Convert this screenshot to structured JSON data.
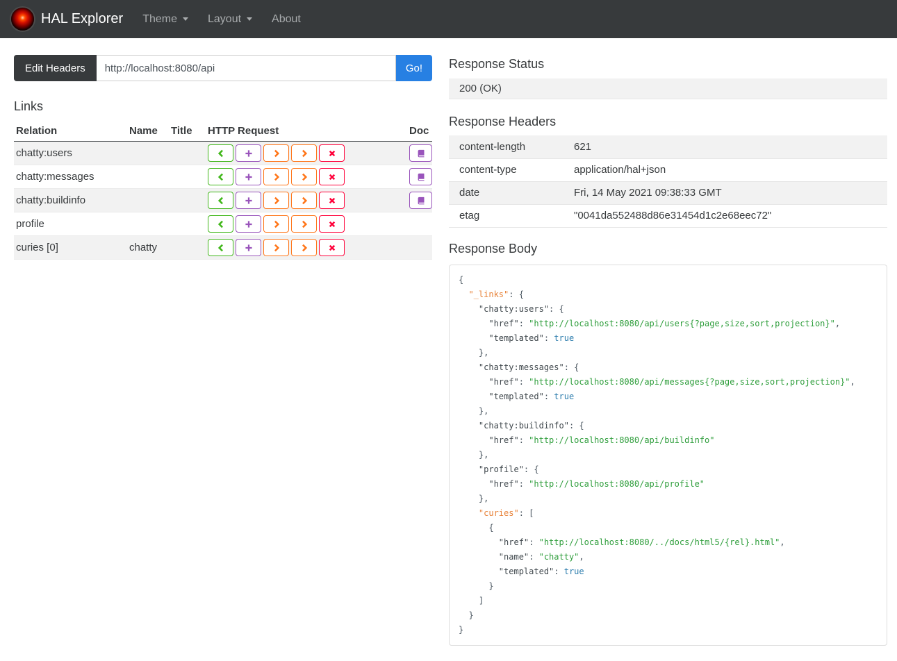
{
  "navbar": {
    "brand": "HAL Explorer",
    "items": [
      {
        "label": "Theme",
        "caret": true
      },
      {
        "label": "Layout",
        "caret": true
      },
      {
        "label": "About",
        "caret": false
      }
    ]
  },
  "request_bar": {
    "edit_headers_label": "Edit Headers",
    "url_value": "http://localhost:8080/api",
    "go_label": "Go!"
  },
  "colors": {
    "primary": "#2780e3",
    "success": "#3fb618",
    "info": "#9954bb",
    "warning": "#ff7518",
    "danger": "#ff0039",
    "dark": "#373a3c"
  },
  "links_section": {
    "title": "Links",
    "columns": [
      "Relation",
      "Name",
      "Title",
      "HTTP Request",
      "Doc"
    ],
    "http_buttons": [
      {
        "name": "get-request-button",
        "icon": "chevron-left-icon",
        "color": "#3fb618"
      },
      {
        "name": "post-request-button",
        "icon": "plus-icon",
        "color": "#9954bb"
      },
      {
        "name": "put-request-button",
        "icon": "chevron-right-icon",
        "color": "#ff7518"
      },
      {
        "name": "patch-request-button",
        "icon": "chevron-right-icon",
        "color": "#ff7518"
      },
      {
        "name": "delete-request-button",
        "icon": "x-icon",
        "color": "#ff0039"
      }
    ],
    "doc_button": {
      "name": "doc-button",
      "icon": "book-icon",
      "color": "#9954bb"
    },
    "rows": [
      {
        "relation": "chatty:users",
        "name": "",
        "title": "",
        "doc": true
      },
      {
        "relation": "chatty:messages",
        "name": "",
        "title": "",
        "doc": true
      },
      {
        "relation": "chatty:buildinfo",
        "name": "",
        "title": "",
        "doc": true
      },
      {
        "relation": "profile",
        "name": "",
        "title": "",
        "doc": false
      },
      {
        "relation": "curies [0]",
        "name": "chatty",
        "title": "",
        "doc": false
      }
    ]
  },
  "response_status": {
    "title": "Response Status",
    "value": "200 (OK)"
  },
  "response_headers": {
    "title": "Response Headers",
    "rows": [
      {
        "name": "content-length",
        "value": "621"
      },
      {
        "name": "content-type",
        "value": "application/hal+json"
      },
      {
        "name": "date",
        "value": "Fri, 14 May 2021 09:38:33 GMT"
      },
      {
        "name": "etag",
        "value": "\"0041da552488d86e31454d1c2e68eec72\""
      }
    ]
  },
  "response_body": {
    "title": "Response Body",
    "lines": [
      [
        {
          "t": "{",
          "c": "p"
        }
      ],
      [
        {
          "t": "  \"_links\"",
          "c": "s"
        },
        {
          "t": ": {",
          "c": "p"
        }
      ],
      [
        {
          "t": "    \"chatty:users\"",
          "c": "k"
        },
        {
          "t": ": {",
          "c": "p"
        }
      ],
      [
        {
          "t": "      \"href\"",
          "c": "k"
        },
        {
          "t": ": ",
          "c": "p"
        },
        {
          "t": "\"http://localhost:8080/api/users{?page,size,sort,projection}\"",
          "c": "v"
        },
        {
          "t": ",",
          "c": "p"
        }
      ],
      [
        {
          "t": "      \"templated\"",
          "c": "k"
        },
        {
          "t": ": ",
          "c": "p"
        },
        {
          "t": "true",
          "c": "b"
        }
      ],
      [
        {
          "t": "    },",
          "c": "p"
        }
      ],
      [
        {
          "t": "    \"chatty:messages\"",
          "c": "k"
        },
        {
          "t": ": {",
          "c": "p"
        }
      ],
      [
        {
          "t": "      \"href\"",
          "c": "k"
        },
        {
          "t": ": ",
          "c": "p"
        },
        {
          "t": "\"http://localhost:8080/api/messages{?page,size,sort,projection}\"",
          "c": "v"
        },
        {
          "t": ",",
          "c": "p"
        }
      ],
      [
        {
          "t": "      \"templated\"",
          "c": "k"
        },
        {
          "t": ": ",
          "c": "p"
        },
        {
          "t": "true",
          "c": "b"
        }
      ],
      [
        {
          "t": "    },",
          "c": "p"
        }
      ],
      [
        {
          "t": "    \"chatty:buildinfo\"",
          "c": "k"
        },
        {
          "t": ": {",
          "c": "p"
        }
      ],
      [
        {
          "t": "      \"href\"",
          "c": "k"
        },
        {
          "t": ": ",
          "c": "p"
        },
        {
          "t": "\"http://localhost:8080/api/buildinfo\"",
          "c": "v"
        }
      ],
      [
        {
          "t": "    },",
          "c": "p"
        }
      ],
      [
        {
          "t": "    \"profile\"",
          "c": "k"
        },
        {
          "t": ": {",
          "c": "p"
        }
      ],
      [
        {
          "t": "      \"href\"",
          "c": "k"
        },
        {
          "t": ": ",
          "c": "p"
        },
        {
          "t": "\"http://localhost:8080/api/profile\"",
          "c": "v"
        }
      ],
      [
        {
          "t": "    },",
          "c": "p"
        }
      ],
      [
        {
          "t": "    \"curies\"",
          "c": "s"
        },
        {
          "t": ": [",
          "c": "p"
        }
      ],
      [
        {
          "t": "      {",
          "c": "p"
        }
      ],
      [
        {
          "t": "        \"href\"",
          "c": "k"
        },
        {
          "t": ": ",
          "c": "p"
        },
        {
          "t": "\"http://localhost:8080/../docs/html5/{rel}.html\"",
          "c": "v"
        },
        {
          "t": ",",
          "c": "p"
        }
      ],
      [
        {
          "t": "        \"name\"",
          "c": "k"
        },
        {
          "t": ": ",
          "c": "p"
        },
        {
          "t": "\"chatty\"",
          "c": "v"
        },
        {
          "t": ",",
          "c": "p"
        }
      ],
      [
        {
          "t": "        \"templated\"",
          "c": "k"
        },
        {
          "t": ": ",
          "c": "p"
        },
        {
          "t": "true",
          "c": "b"
        }
      ],
      [
        {
          "t": "      }",
          "c": "p"
        }
      ],
      [
        {
          "t": "    ]",
          "c": "p"
        }
      ],
      [
        {
          "t": "  }",
          "c": "p"
        }
      ],
      [
        {
          "t": "}",
          "c": "p"
        }
      ]
    ]
  }
}
